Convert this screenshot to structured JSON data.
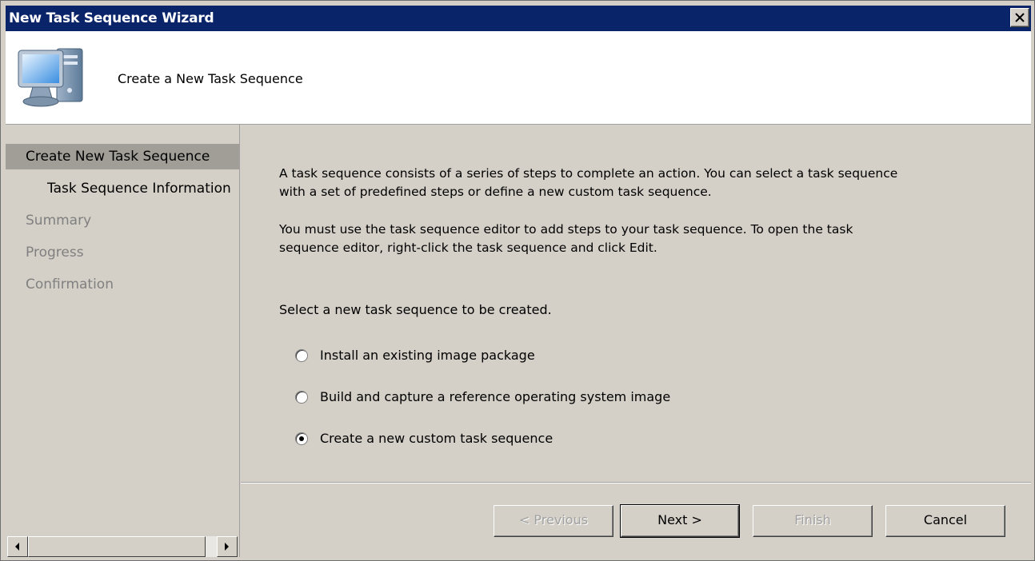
{
  "window": {
    "title": "New Task Sequence Wizard"
  },
  "header": {
    "title": "Create a New Task Sequence",
    "icon": "computer-icon"
  },
  "nav": {
    "items": [
      {
        "label": "Create New Task Sequence",
        "state": "selected"
      },
      {
        "label": "Task Sequence Information",
        "state": "enabled"
      },
      {
        "label": "Summary",
        "state": "disabled"
      },
      {
        "label": "Progress",
        "state": "disabled"
      },
      {
        "label": "Confirmation",
        "state": "disabled"
      }
    ]
  },
  "content": {
    "paragraph1_line1": "A task sequence consists of a series of steps to complete an action. You can select a task sequence",
    "paragraph1_line2": "with a set of predefined steps or define a new custom task sequence.",
    "paragraph2_line1": "You must use the task sequence editor to add steps to your task sequence. To open the task",
    "paragraph2_line2": "sequence editor, right-click the task sequence and click Edit.",
    "prompt": "Select a new task sequence to be created.",
    "options": [
      {
        "label": "Install an existing image package",
        "checked": false
      },
      {
        "label": "Build and capture a reference operating system image",
        "checked": false
      },
      {
        "label": "Create a new custom task sequence",
        "checked": true
      }
    ]
  },
  "buttons": {
    "previous": "< Previous",
    "next": "Next >",
    "finish": "Finish",
    "cancel": "Cancel"
  },
  "colors": {
    "titlebar": "#0a246a",
    "face": "#d4d0c8",
    "nav_selected": "#a19e98",
    "disabled_text": "#808080"
  }
}
